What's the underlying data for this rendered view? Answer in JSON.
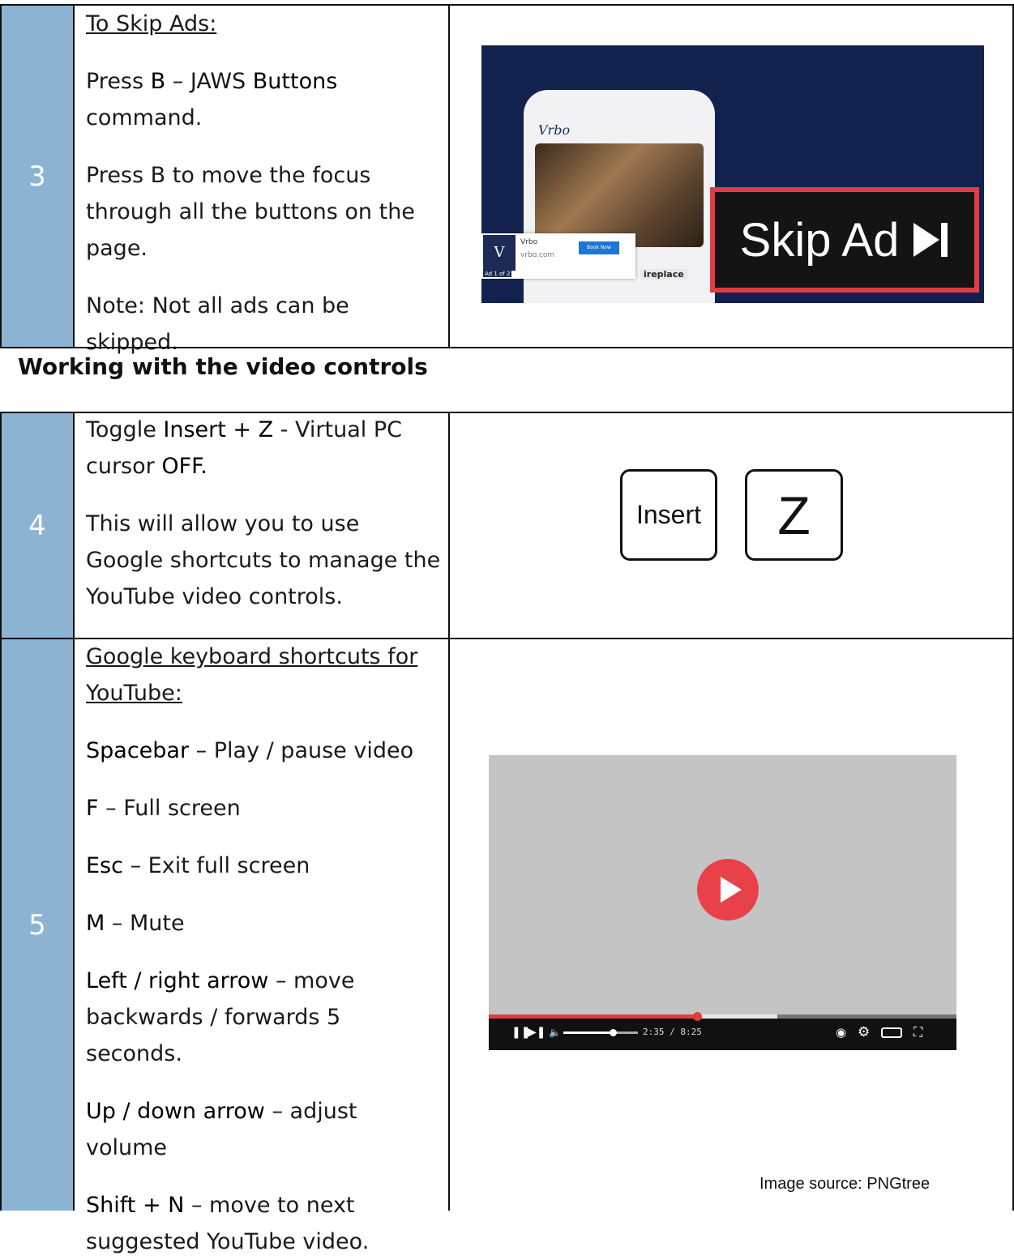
{
  "row3": {
    "number": "3",
    "heading": "To Skip Ads:",
    "p1_pre": "Press ",
    "p1_key": "B",
    "p1_mid": " – JAWS ",
    "p1_cmd": "Buttons",
    "p1_post": " command.",
    "p2": "Press B to move the focus through all the buttons on the page.",
    "p3": "Note: Not all ads can be skipped.",
    "ad": {
      "brand": "Vrbo",
      "card_name": "Vrbo",
      "card_url": "vrbo.com",
      "card_button": "Book Now",
      "card_tag": "Ad 1 of 2",
      "fireplace_text": "ireplace",
      "skip_label": "Skip Ad",
      "skip_icon": "skip-next-icon"
    }
  },
  "section": {
    "title": "Working with the video controls"
  },
  "row4": {
    "number": "4",
    "p1_pre": "Toggle ",
    "p1_keys": "Insert + Z",
    "p1_mid": " - Virtual PC cursor ",
    "p1_state": "OFF.",
    "p2": "This will allow you to use Google shortcuts to manage the YouTube video controls.",
    "keys": [
      "Insert",
      "Z"
    ]
  },
  "row5": {
    "number": "5",
    "heading": "Google keyboard shortcuts for YouTube:",
    "shortcuts": [
      {
        "key": "Spacebar",
        "desc": " – Play / pause video"
      },
      {
        "key": "F",
        "desc": " – Full screen"
      },
      {
        "key": "Esc",
        "desc": " – Exit full screen"
      },
      {
        "key": "M",
        "desc": " – Mute"
      },
      {
        "key": "Left / right arrow",
        "desc": " – move backwards / forwards 5 seconds."
      },
      {
        "key": "Up / down arrow",
        "desc": " – adjust volume"
      },
      {
        "key": "Shift + N",
        "desc": " – move to next suggested YouTube video."
      }
    ],
    "video": {
      "time": "2:35 / 8:25",
      "progress_fraction": 0.446,
      "volume_fraction": 0.66,
      "progress_color": "#e53b3b",
      "play_color": "#e8414a"
    },
    "credit": "Image source: PNGtree"
  }
}
